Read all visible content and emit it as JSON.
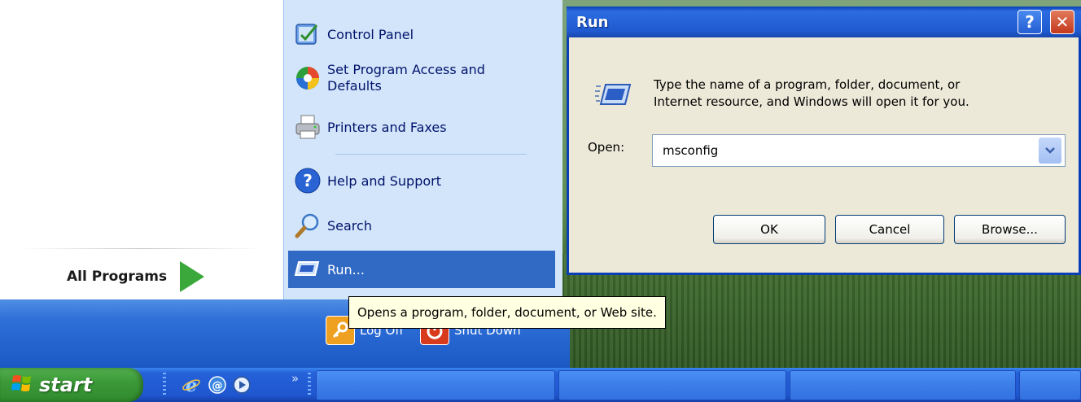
{
  "start_menu": {
    "all_programs_label": "All Programs",
    "right_items": [
      {
        "label": "Control Panel",
        "icon": "control-panel-icon"
      },
      {
        "label": "Set Program Access and\nDefaults",
        "icon": "set-program-access-icon"
      },
      {
        "label": "Printers and Faxes",
        "icon": "printer-icon"
      },
      {
        "label": "Help and Support",
        "icon": "help-icon"
      },
      {
        "label": "Search",
        "icon": "search-icon"
      },
      {
        "label": "Run...",
        "icon": "run-icon"
      }
    ],
    "logoff_label": "Log Off",
    "shutdown_label": "Shut Down"
  },
  "tooltip": "Opens a program, folder, document, or Web site.",
  "taskbar": {
    "start_label": "start"
  },
  "run_dialog": {
    "title": "Run",
    "help_label": "?",
    "close_label": "✕",
    "description_line1": "Type the name of a program, folder, document, or",
    "description_line2": "Internet resource, and Windows will open it for you.",
    "open_label": "Open:",
    "open_value": "msconfig",
    "ok_label": "OK",
    "cancel_label": "Cancel",
    "browse_label": "Browse..."
  },
  "colors": {
    "menu_blue": "#1b58c4",
    "highlight": "#316ac5",
    "start_green": "#3c9a38",
    "dialog_bg": "#ece9d8",
    "tooltip_bg": "#ffffe1"
  }
}
